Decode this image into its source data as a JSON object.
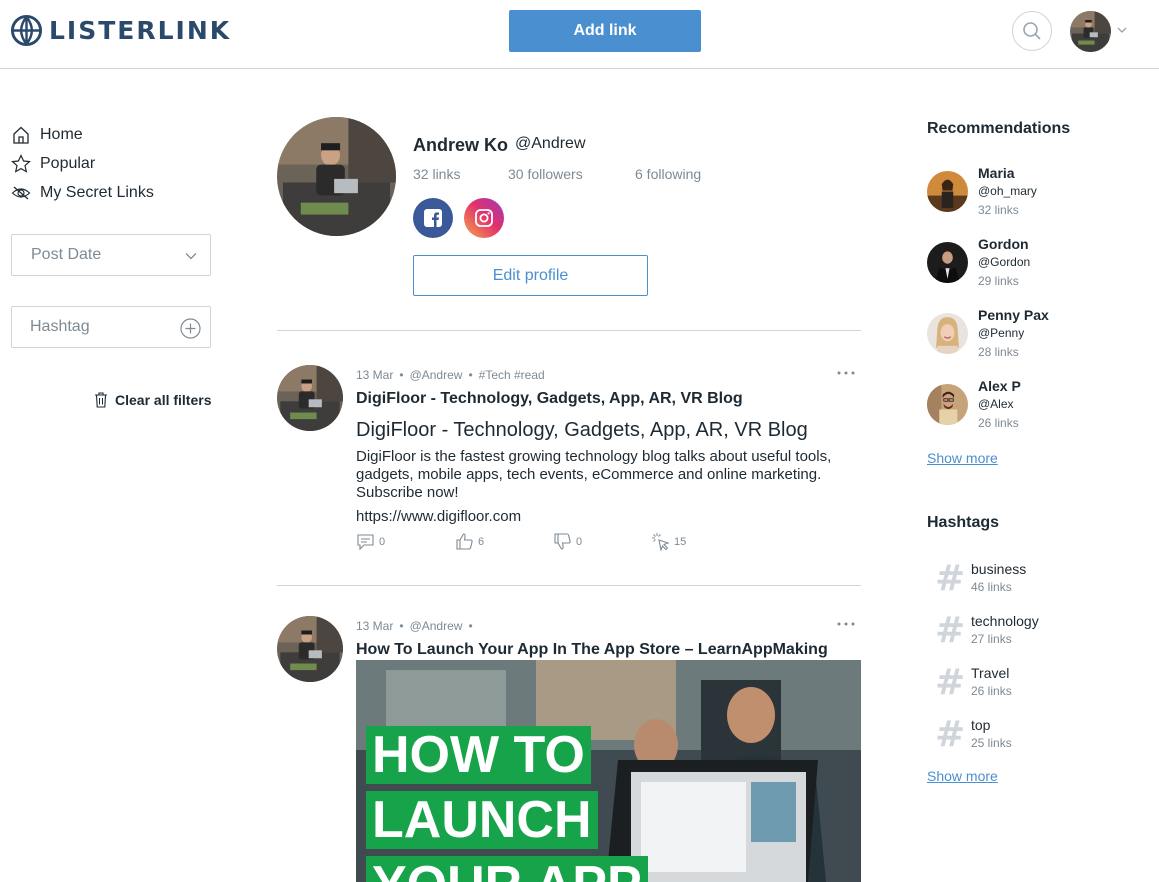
{
  "header": {
    "logo_text": "LISTERLINK",
    "add_link_label": "Add link"
  },
  "nav": {
    "items": [
      {
        "label": "Home",
        "icon": "home-icon"
      },
      {
        "label": "Popular",
        "icon": "star-icon"
      },
      {
        "label": "My Secret Links",
        "icon": "eye-slash-icon"
      }
    ]
  },
  "filters": {
    "sort_value": "Post Date",
    "hashtag_placeholder": "Hashtag",
    "clear_label": "Clear all filters"
  },
  "profile": {
    "name": "Andrew Ko",
    "handle": "@Andrew",
    "links": "32 links",
    "followers": "30 followers",
    "following": "6 following",
    "edit_label": "Edit profile"
  },
  "posts": [
    {
      "date": "13 Mar",
      "author": "@Andrew",
      "tags": "#Tech #read",
      "title": "DigiFloor - Technology, Gadgets, App, AR, VR Blog",
      "link_title": "DigiFloor - Technology, Gadgets, App, AR, VR Blog",
      "description": "DigiFloor is the fastest growing technology blog talks about useful tools, gadgets, mobile apps, tech events, eCommerce and online marketing. Subscribe now!",
      "url": "https://www.digifloor.com",
      "comments": "0",
      "likes": "6",
      "dislikes": "0",
      "clicks": "15"
    },
    {
      "date": "13 Mar",
      "author": "@Andrew",
      "title": "How To Launch Your App In The App Store – LearnAppMaking",
      "image_text": [
        "HOW TO",
        "LAUNCH",
        "YOUR APP"
      ]
    }
  ],
  "recommendations": {
    "heading": "Recommendations",
    "users": [
      {
        "name": "Maria",
        "handle": "@oh_mary",
        "links": "32 links"
      },
      {
        "name": "Gordon",
        "handle": "@Gordon",
        "links": "29 links"
      },
      {
        "name": "Penny Pax",
        "handle": "@Penny",
        "links": "28 links"
      },
      {
        "name": "Alex P",
        "handle": "@Alex",
        "links": "26 links"
      }
    ],
    "show_more": "Show more"
  },
  "hashtags": {
    "heading": "Hashtags",
    "items": [
      {
        "name": "business",
        "links": "46 links"
      },
      {
        "name": "technology",
        "links": "27 links"
      },
      {
        "name": "Travel",
        "links": "26 links"
      },
      {
        "name": "top",
        "links": "25 links"
      }
    ],
    "show_more": "Show more"
  },
  "colors": {
    "accent": "#4a8fd0",
    "text": "#1e2a33",
    "muted": "#7e8a94",
    "border": "#cfd5da",
    "headline_green": "#17a34a"
  }
}
